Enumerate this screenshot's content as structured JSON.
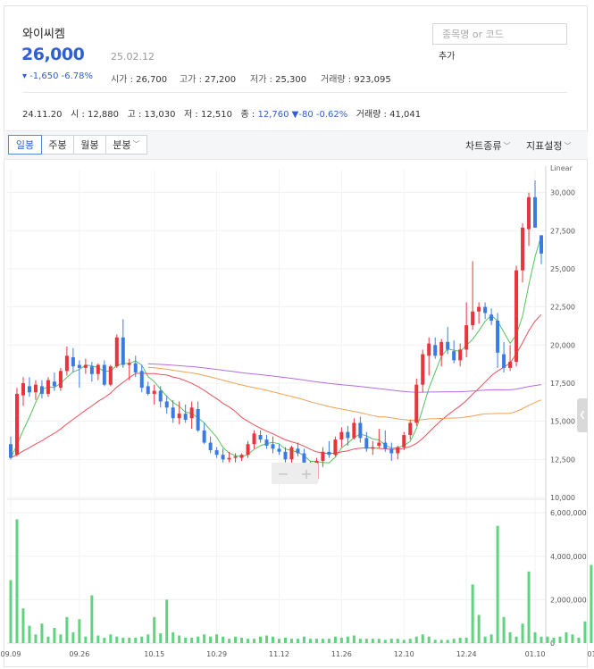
{
  "stock": {
    "name": "와이씨켐",
    "price": "26,000",
    "date": "25.02.12",
    "change": "▾ -1,650 -6.78%",
    "open_label": "시가 : ",
    "open": "26,700",
    "high_label": "고가 : ",
    "high": "27,200",
    "low_label": "저가 : ",
    "low": "25,300",
    "volume_label": "거래량 : ",
    "volume": "923,095"
  },
  "search": {
    "placeholder": "종목명 or 코드",
    "add_label": "추가"
  },
  "prev_day": {
    "date": "24.11.20",
    "open_label": "시 : ",
    "open": "12,880",
    "high_label": "고 : ",
    "high": "13,030",
    "low_label": "저 : ",
    "low": "12,510",
    "close_label": "종 : ",
    "close": "12,760",
    "change": "▼-80 -0.62%",
    "volume_label": "거래량 : ",
    "volume": "41,041"
  },
  "toolbar": {
    "periods": [
      "일봉",
      "주봉",
      "월봉",
      "분봉"
    ],
    "active_period": "일봉",
    "chart_type_label": "차트종류",
    "indicator_label": "지표설정"
  },
  "zoom": {
    "minus": "−",
    "plus": "+"
  },
  "colors": {
    "up": "#e8343d",
    "down": "#3a7be0",
    "ma5": "#56c35e",
    "ma20": "#e8505a",
    "ma60": "#f0a052",
    "ma120": "#b46ee0",
    "volume": "#5fd37f",
    "accent": "#2f5fd0"
  },
  "chart_data": {
    "type": "candlestick",
    "scale_label": "Linear",
    "price_ylim": [
      10000,
      31500
    ],
    "price_ticks": [
      "10,000",
      "12,500",
      "15,000",
      "17,500",
      "20,000",
      "22,500",
      "25,000",
      "27,500",
      "30,000"
    ],
    "volume_ylim": [
      0,
      6500000
    ],
    "volume_ticks": [
      "0",
      "2,000,000",
      "4,000,000",
      "6,000,000"
    ],
    "x_ticks": [
      {
        "label": "09.09",
        "index": 0
      },
      {
        "label": "09.26",
        "index": 11
      },
      {
        "label": "10.15",
        "index": 23
      },
      {
        "label": "10.29",
        "index": 33
      },
      {
        "label": "11.12",
        "index": 43
      },
      {
        "label": "11.26",
        "index": 53
      },
      {
        "label": "12.10",
        "index": 63
      },
      {
        "label": "12.24",
        "index": 73
      },
      {
        "label": "01.10",
        "index": 84
      },
      {
        "label": "01.24",
        "index": 94
      }
    ],
    "ohlc": [
      [
        13500,
        14000,
        12500,
        12600
      ],
      [
        12800,
        17200,
        12700,
        16800
      ],
      [
        16700,
        17900,
        16000,
        17500
      ],
      [
        17300,
        17900,
        16600,
        16900
      ],
      [
        16900,
        17700,
        16400,
        17400
      ],
      [
        17300,
        17700,
        16500,
        16800
      ],
      [
        16800,
        17900,
        16600,
        17700
      ],
      [
        17600,
        18200,
        17000,
        17300
      ],
      [
        17200,
        18500,
        17000,
        18300
      ],
      [
        18300,
        19900,
        18000,
        19300
      ],
      [
        19200,
        19800,
        18200,
        18600
      ],
      [
        18700,
        19000,
        17200,
        18500
      ],
      [
        18500,
        19100,
        18100,
        18700
      ],
      [
        18600,
        18900,
        17600,
        18100
      ],
      [
        18100,
        18800,
        17700,
        18700
      ],
      [
        18700,
        19000,
        17300,
        17400
      ],
      [
        17400,
        18700,
        17300,
        18600
      ],
      [
        18600,
        20700,
        18500,
        20500
      ],
      [
        20500,
        21700,
        18500,
        18700
      ],
      [
        18700,
        19100,
        17700,
        18800
      ],
      [
        18800,
        19300,
        17900,
        18200
      ],
      [
        18300,
        18700,
        16900,
        17200
      ],
      [
        17300,
        17600,
        16700,
        16800
      ],
      [
        16800,
        17400,
        16100,
        17000
      ],
      [
        17000,
        17300,
        15900,
        16300
      ],
      [
        16300,
        16700,
        15500,
        15900
      ],
      [
        15900,
        16400,
        14900,
        15200
      ],
      [
        15200,
        16300,
        14800,
        15500
      ],
      [
        15500,
        16100,
        14900,
        15100
      ],
      [
        15200,
        16300,
        14500,
        15900
      ],
      [
        15800,
        16300,
        14300,
        14400
      ],
      [
        14400,
        14900,
        13500,
        13600
      ],
      [
        13600,
        14000,
        12900,
        13100
      ],
      [
        13100,
        13300,
        12600,
        12800
      ],
      [
        12800,
        13200,
        12300,
        12500
      ],
      [
        12500,
        13000,
        12300,
        12600
      ],
      [
        12600,
        12900,
        12300,
        12700
      ],
      [
        12600,
        12900,
        12400,
        12800
      ],
      [
        12800,
        13700,
        12600,
        13500
      ],
      [
        13500,
        14400,
        13200,
        14200
      ],
      [
        14100,
        14400,
        13600,
        13800
      ],
      [
        13800,
        14100,
        13200,
        13400
      ],
      [
        13500,
        14000,
        12900,
        13200
      ],
      [
        13200,
        13500,
        12800,
        13000
      ],
      [
        13000,
        13300,
        12300,
        12500
      ],
      [
        12500,
        13400,
        12200,
        13300
      ],
      [
        13200,
        13600,
        12700,
        12900
      ],
      [
        12900,
        13200,
        11800,
        12000
      ],
      [
        12100,
        12400,
        11000,
        11200
      ],
      [
        11200,
        12600,
        11000,
        12400
      ],
      [
        12400,
        13300,
        12000,
        13000
      ],
      [
        13000,
        13700,
        12600,
        12800
      ],
      [
        12800,
        14000,
        12700,
        13800
      ],
      [
        13800,
        14600,
        13300,
        14300
      ],
      [
        14300,
        14700,
        13400,
        13900
      ],
      [
        13900,
        15200,
        13800,
        14900
      ],
      [
        14900,
        15300,
        13600,
        13900
      ],
      [
        13900,
        14300,
        13000,
        13200
      ],
      [
        13200,
        13700,
        12800,
        13300
      ],
      [
        13400,
        14500,
        13200,
        13600
      ],
      [
        13600,
        14400,
        13000,
        13200
      ],
      [
        13200,
        13600,
        12400,
        12900
      ],
      [
        12900,
        13400,
        12500,
        13300
      ],
      [
        13300,
        14300,
        13100,
        14100
      ],
      [
        14100,
        15100,
        13800,
        14900
      ],
      [
        14900,
        17800,
        14700,
        17400
      ],
      [
        17400,
        19700,
        16900,
        19400
      ],
      [
        19300,
        20500,
        18000,
        20100
      ],
      [
        20000,
        20500,
        19100,
        19300
      ],
      [
        19300,
        20400,
        18600,
        20200
      ],
      [
        20200,
        21200,
        19400,
        19700
      ],
      [
        19600,
        20300,
        18800,
        19000
      ],
      [
        19000,
        20100,
        18600,
        19700
      ],
      [
        19700,
        22800,
        19200,
        21300
      ],
      [
        21300,
        25500,
        21000,
        22200
      ],
      [
        22200,
        22800,
        21400,
        22500
      ],
      [
        22500,
        22800,
        21700,
        22100
      ],
      [
        22000,
        22400,
        21300,
        21600
      ],
      [
        21600,
        22100,
        18500,
        19500
      ],
      [
        19400,
        20200,
        18200,
        18500
      ],
      [
        18500,
        20000,
        18300,
        18900
      ],
      [
        18900,
        25200,
        18600,
        24900
      ],
      [
        24900,
        28000,
        24100,
        27700
      ],
      [
        27600,
        30000,
        26500,
        29700
      ],
      [
        29700,
        30800,
        27700,
        27700
      ],
      [
        27200,
        27200,
        25300,
        26000
      ]
    ],
    "volume": [
      2900000,
      5700000,
      1600000,
      800000,
      400000,
      900000,
      300000,
      700000,
      400000,
      1200000,
      500000,
      1100000,
      300000,
      2200000,
      350000,
      250000,
      400000,
      300000,
      250000,
      250000,
      250000,
      300000,
      400000,
      1200000,
      450000,
      2000000,
      500000,
      350000,
      250000,
      250000,
      300000,
      400000,
      300000,
      400000,
      300000,
      200000,
      300000,
      250000,
      200000,
      200000,
      300000,
      350000,
      300000,
      200000,
      250000,
      200000,
      200000,
      300000,
      200000,
      200000,
      200000,
      200000,
      300000,
      250000,
      300000,
      350000,
      200000,
      200000,
      200000,
      200000,
      150000,
      200000,
      200000,
      150000,
      200000,
      300000,
      400000,
      300000,
      150000,
      150000,
      150000,
      200000,
      250000,
      250000,
      2700000,
      1300000,
      300000,
      400000,
      5400000,
      1200000,
      500000,
      300000,
      900000,
      3300000,
      500000,
      300000,
      300000,
      250000,
      300000,
      500000,
      400000,
      250000,
      1000000,
      3600000,
      5100000,
      2400000,
      1800000,
      900000
    ],
    "moving_averages": [
      {
        "period": 5,
        "color": "#56c35e"
      },
      {
        "period": 20,
        "color": "#e8505a"
      },
      {
        "period": 60,
        "color": "#f0a052"
      },
      {
        "period": 120,
        "color": "#b46ee0"
      }
    ]
  }
}
